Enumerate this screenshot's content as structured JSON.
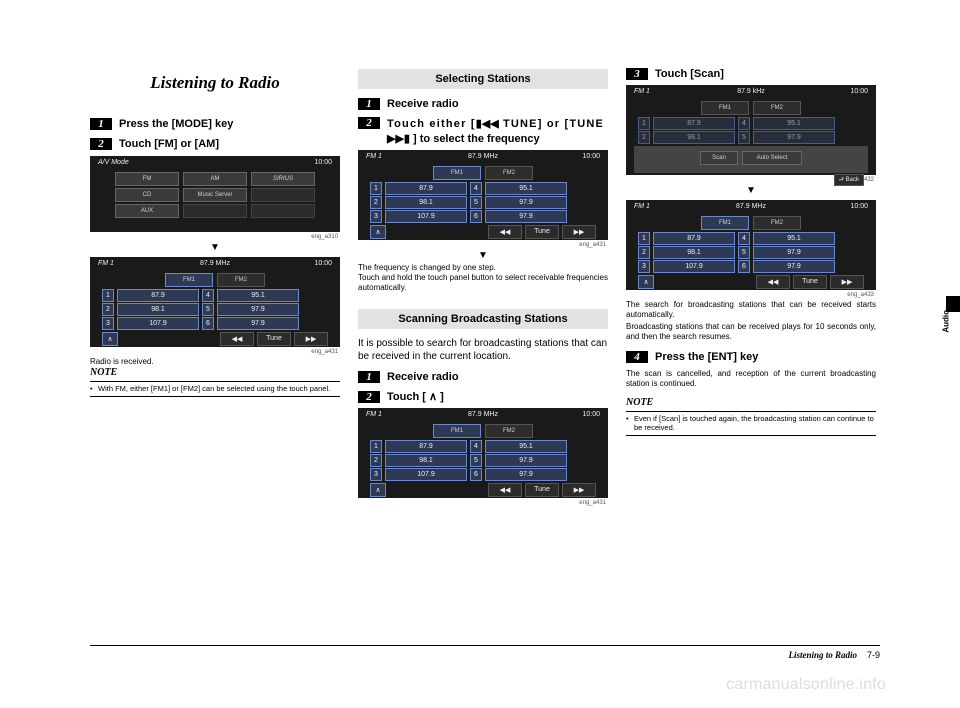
{
  "title": "Listening to Radio",
  "col1": {
    "step1": "Press the [MODE] key",
    "step2": "Touch [FM] or [AM]",
    "shot1": {
      "corner": "A/V Mode",
      "time": "10:00",
      "row1": [
        "FM",
        "AM",
        "SIRIUS"
      ],
      "row2": [
        "CD",
        "Music Server",
        ""
      ],
      "row3": [
        "AUX",
        "",
        ""
      ],
      "cap": "eng_a310"
    },
    "shot2": {
      "corner": "FM 1",
      "freq": "87.9  MHz",
      "time": "10:00",
      "tabs": [
        "FM1",
        "FM2"
      ],
      "presets": [
        [
          "1",
          "87.9",
          "4",
          "95.1"
        ],
        [
          "2",
          "98.1",
          "5",
          "97.9"
        ],
        [
          "3",
          "107.9",
          "6",
          "97.9"
        ]
      ],
      "tune": [
        "◀◀",
        "Tune",
        "▶▶"
      ],
      "cap": "eng_a431"
    },
    "after": "Radio is received.",
    "note_label": "NOTE",
    "note_bullet": "With FM, either [FM1] or [FM2] can be selected using the touch panel."
  },
  "col2": {
    "sec1": "Selecting Stations",
    "s1_step1": "Receive radio",
    "s1_step2a": "Touch either [",
    "s1_step2b": " TUNE] or [TUNE ",
    "s1_step2c": " ] to select the frequency",
    "shot3": {
      "corner": "FM 1",
      "freq": "87.9  MHz",
      "time": "10:00",
      "tabs": [
        "FM1",
        "FM2"
      ],
      "presets": [
        [
          "1",
          "87.9",
          "4",
          "95.1"
        ],
        [
          "2",
          "98.1",
          "5",
          "97.9"
        ],
        [
          "3",
          "107.9",
          "6",
          "97.9"
        ]
      ],
      "tune": [
        "◀◀",
        "Tune",
        "▶▶"
      ],
      "cap": "eng_a431"
    },
    "s1_body1": "The frequency is changed by one step.",
    "s1_body2": "Touch and hold the touch panel button to select receivable frequencies automatically.",
    "sec2": "Scanning Broadcasting Stations",
    "s2_intro": "It is possible to search for broadcasting stations that can be received in the current location.",
    "s2_step1": "Receive radio",
    "s2_step2a": "Touch [ ",
    "s2_step2b": " ]",
    "shot4": {
      "corner": "FM 1",
      "freq": "87.9  MHz",
      "time": "10:00",
      "tabs": [
        "FM1",
        "FM2"
      ],
      "presets": [
        [
          "1",
          "87.9",
          "4",
          "95.1"
        ],
        [
          "2",
          "98.1",
          "5",
          "97.9"
        ],
        [
          "3",
          "107.9",
          "6",
          "97.9"
        ]
      ],
      "tune": [
        "◀◀",
        "Tune",
        "▶▶"
      ],
      "cap": "eng_a431"
    }
  },
  "col3": {
    "step3": "Touch [Scan]",
    "shot5": {
      "corner": "FM 1",
      "freq": "87.9  kHz",
      "time": "10:00",
      "tabs": [
        "FM1",
        "FM2"
      ],
      "presets": [
        [
          "1",
          "87.9",
          "4",
          "95.1"
        ],
        [
          "2",
          "98.1",
          "5",
          "97.9"
        ]
      ],
      "scanrow": [
        "Scan",
        "Auto Select"
      ],
      "back": "Back",
      "cap": "eng_a432"
    },
    "shot6": {
      "corner": "FM 1",
      "freq": "87.9  MHz",
      "time": "10:00",
      "tabs": [
        "FM1",
        "FM2"
      ],
      "presets": [
        [
          "1",
          "87.9",
          "4",
          "95.1"
        ],
        [
          "2",
          "98.1",
          "5",
          "97.9"
        ],
        [
          "3",
          "107.9",
          "6",
          "97.9"
        ]
      ],
      "tune": [
        "◀◀",
        "Tune",
        "▶▶"
      ],
      "cap": "eng_a433"
    },
    "body1": "The search for broadcasting stations that can be received starts automatically.",
    "body2": "Broadcasting stations that can be received plays for 10 seconds only, and then the search resumes.",
    "step4": "Press the [ENT] key",
    "body3": "The scan is cancelled, and reception of the current broadcasting station is continued.",
    "note_label": "NOTE",
    "note_bullet": "Even if [Scan] is touched again, the broadcasting station can continue to be received."
  },
  "side_label": "Audio",
  "footer_title": "Listening to Radio",
  "footer_page": "7-9",
  "watermark": "carmanualsonline.info",
  "nums": {
    "n1": "1",
    "n2": "2",
    "n3": "3",
    "n4": "4"
  },
  "arrow_down": "▼",
  "icon_rew": "▮◀◀",
  "icon_fwd": "▶▶▮",
  "icon_up": "∧"
}
